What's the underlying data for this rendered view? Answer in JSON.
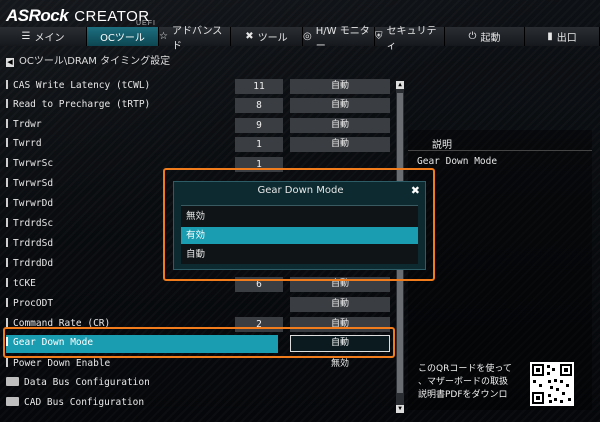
{
  "brand": {
    "name": "ASRock",
    "product": "CREATOR",
    "tag": "UEFI"
  },
  "nav": {
    "tabs": [
      {
        "label": "メイン",
        "icon": "menu-icon"
      },
      {
        "label": "OCツール",
        "icon": "",
        "active": true
      },
      {
        "label": "アドバンスド",
        "icon": "star-icon"
      },
      {
        "label": "ツール",
        "icon": "tools-icon"
      },
      {
        "label": "H/W モニター",
        "icon": "monitor-icon"
      },
      {
        "label": "セキュリティ",
        "icon": "shield-icon"
      },
      {
        "label": "起動",
        "icon": "power-icon"
      },
      {
        "label": "出口",
        "icon": "exit-icon"
      }
    ]
  },
  "breadcrumb": "OCツール\\DRAM タイミング設定",
  "settings": [
    {
      "label": "CAS Write Latency (tCWL)",
      "num": "11",
      "value": "自動"
    },
    {
      "label": "Read to Precharge (tRTP)",
      "num": "8",
      "value": "自動"
    },
    {
      "label": "Trdwr",
      "num": "9",
      "value": "自動"
    },
    {
      "label": "Twrrd",
      "num": "1",
      "value": "自動"
    },
    {
      "label": "TwrwrSc",
      "num": "1",
      "value": ""
    },
    {
      "label": "TwrwrSd",
      "num": "",
      "value": ""
    },
    {
      "label": "TwrwrDd",
      "num": "",
      "value": ""
    },
    {
      "label": "TrdrdSc",
      "num": "",
      "value": ""
    },
    {
      "label": "TrdrdSd",
      "num": "",
      "value": ""
    },
    {
      "label": "TrdrdDd",
      "num": "",
      "value": ""
    },
    {
      "label": "tCKE",
      "num": "6",
      "value": "自動"
    },
    {
      "label": "ProcODT",
      "num": "",
      "value": "自動"
    },
    {
      "label": "Command Rate (CR)",
      "num": "2",
      "value": "自動"
    }
  ],
  "selected_setting": {
    "label": "Gear Down Mode",
    "value": "自動"
  },
  "power_down": {
    "label": "Power Down Enable",
    "value": "無効"
  },
  "folders": [
    {
      "label": "Data Bus Configuration"
    },
    {
      "label": "CAD Bus Configuration"
    }
  ],
  "description": {
    "header": "説明",
    "body": "Gear Down Mode"
  },
  "qr_text": {
    "line1": "このQRコードを使って",
    "line2": "、マザーボードの取扱",
    "line3": "説明書PDFをダウンロ"
  },
  "popup": {
    "title": "Gear Down Mode",
    "options": [
      "無効",
      "有効",
      "自動"
    ],
    "selected_index": 1
  },
  "colors": {
    "accent": "#1a9db0",
    "highlight_frame": "#f07c1c",
    "active_tab": "#1d6f80"
  }
}
